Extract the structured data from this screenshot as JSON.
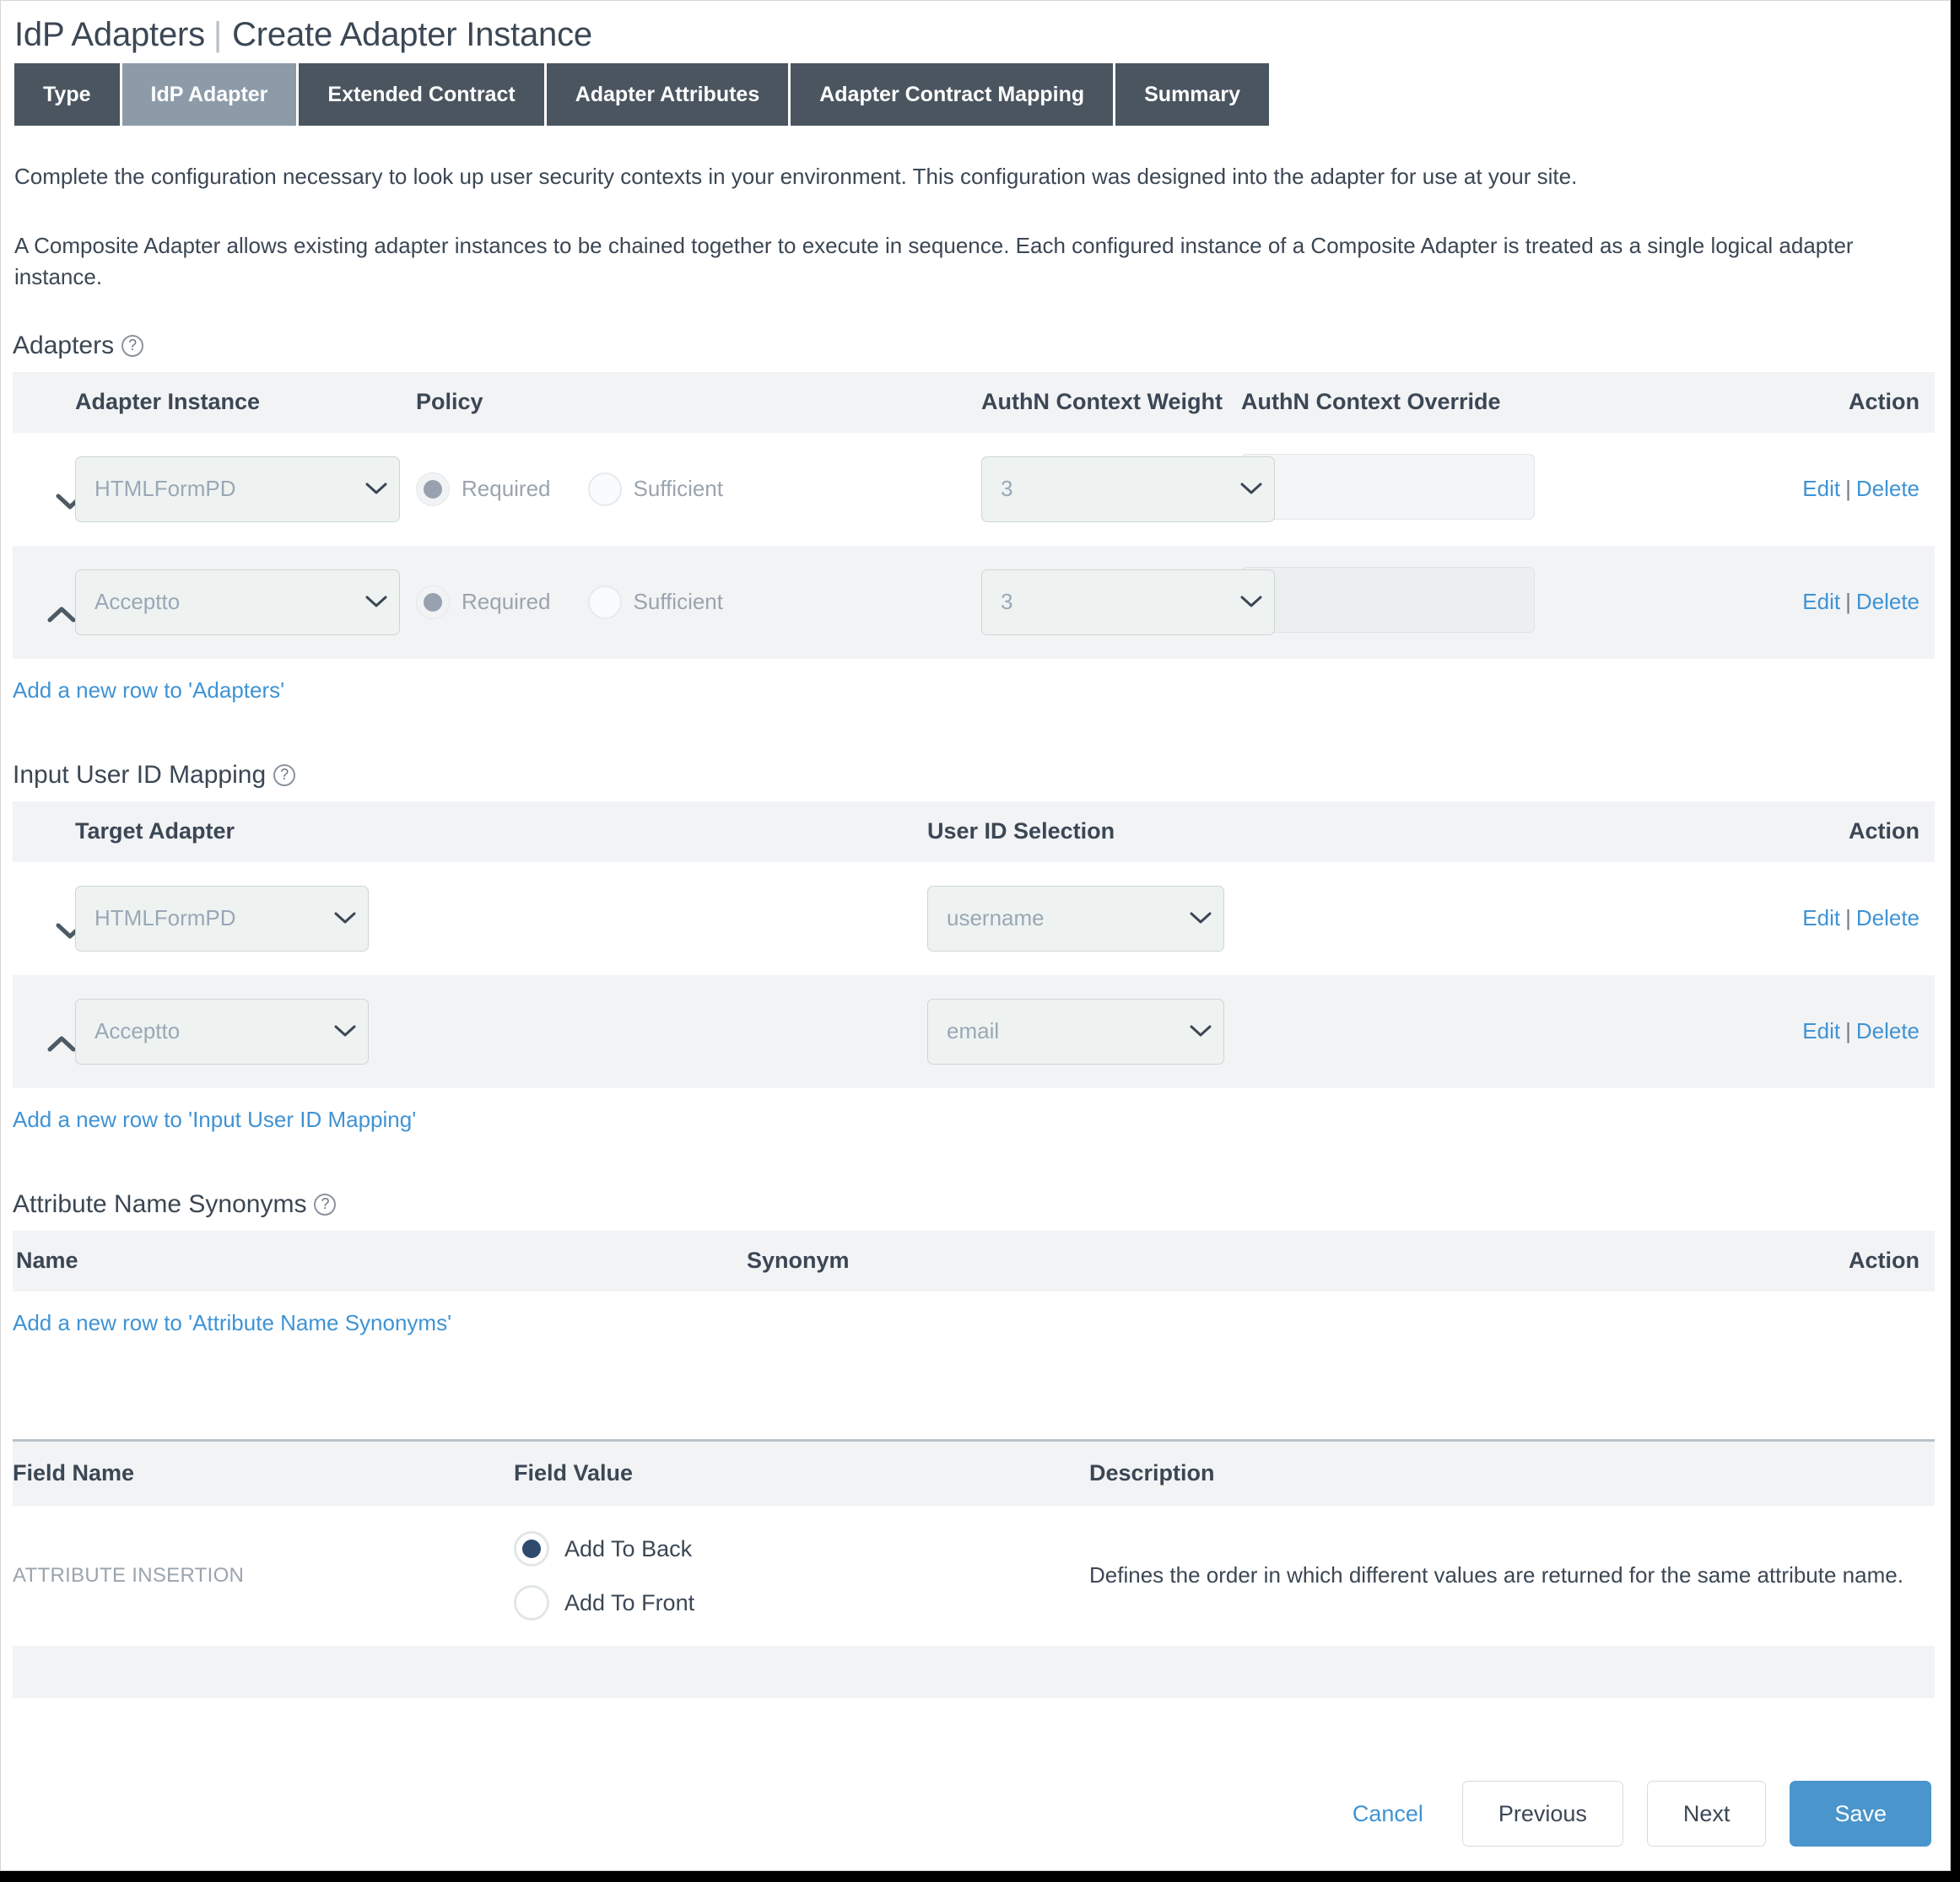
{
  "header": {
    "breadcrumb_parent": "IdP Adapters",
    "separator": "|",
    "title": "Create Adapter Instance"
  },
  "tabs": [
    {
      "label": "Type",
      "active": false
    },
    {
      "label": "IdP Adapter",
      "active": true
    },
    {
      "label": "Extended Contract",
      "active": false
    },
    {
      "label": "Adapter Attributes",
      "active": false
    },
    {
      "label": "Adapter Contract Mapping",
      "active": false
    },
    {
      "label": "Summary",
      "active": false
    }
  ],
  "intro": {
    "paragraph1": "Complete the configuration necessary to look up user security contexts in your environment. This configuration was designed into the adapter for use at your site.",
    "paragraph2": "A Composite Adapter allows existing adapter instances to be chained together to execute in sequence. Each configured instance of a Composite Adapter is treated as a single logical adapter instance."
  },
  "adapters_section": {
    "title": "Adapters",
    "help_glyph": "?",
    "columns": {
      "adapter_instance": "Adapter Instance",
      "policy": "Policy",
      "authn_context_weight": "AuthN Context Weight",
      "authn_context_override": "AuthN Context Override",
      "action": "Action"
    },
    "rows": [
      {
        "move_icon": "chevron-down-icon",
        "adapter_instance": "HTMLFormPD",
        "policy_options": [
          {
            "label": "Required",
            "selected": true
          },
          {
            "label": "Sufficient",
            "selected": false
          }
        ],
        "authn_context_weight": "3",
        "authn_context_override": "",
        "edit_label": "Edit",
        "separator": "|",
        "delete_label": "Delete"
      },
      {
        "move_icon": "chevron-up-icon",
        "adapter_instance": "Acceptto",
        "policy_options": [
          {
            "label": "Required",
            "selected": true
          },
          {
            "label": "Sufficient",
            "selected": false
          }
        ],
        "authn_context_weight": "3",
        "authn_context_override": "",
        "edit_label": "Edit",
        "separator": "|",
        "delete_label": "Delete"
      }
    ],
    "add_row_label": "Add a new row to 'Adapters'"
  },
  "input_user_id_section": {
    "title": "Input User ID Mapping",
    "help_glyph": "?",
    "columns": {
      "target_adapter": "Target Adapter",
      "user_id_selection": "User ID Selection",
      "action": "Action"
    },
    "rows": [
      {
        "move_icon": "chevron-down-icon",
        "target_adapter": "HTMLFormPD",
        "user_id_selection": "username",
        "edit_label": "Edit",
        "separator": "|",
        "delete_label": "Delete"
      },
      {
        "move_icon": "chevron-up-icon",
        "target_adapter": "Acceptto",
        "user_id_selection": "email",
        "edit_label": "Edit",
        "separator": "|",
        "delete_label": "Delete"
      }
    ],
    "add_row_label": "Add a new row to 'Input User ID Mapping'"
  },
  "attribute_synonyms_section": {
    "title": "Attribute Name Synonyms",
    "help_glyph": "?",
    "columns": {
      "name": "Name",
      "synonym": "Synonym",
      "action": "Action"
    },
    "rows": [],
    "add_row_label": "Add a new row to 'Attribute Name Synonyms'"
  },
  "field_table": {
    "columns": {
      "field_name": "Field Name",
      "field_value": "Field Value",
      "description": "Description"
    },
    "rows": [
      {
        "field_name": "ATTRIBUTE INSERTION",
        "options": [
          {
            "label": "Add To Back",
            "selected": true
          },
          {
            "label": "Add To Front",
            "selected": false
          }
        ],
        "description": "Defines the order in which different values are returned for the same attribute name."
      }
    ]
  },
  "footer": {
    "cancel_label": "Cancel",
    "previous_label": "Previous",
    "next_label": "Next",
    "save_label": "Save"
  },
  "colors": {
    "tab_inactive": "#4a555f",
    "tab_active": "#8d9ba9",
    "link": "#3f93d4",
    "primary_button": "#4a95cc",
    "header_row": "#f2f3f5",
    "select_fill": "#eef3f2",
    "radio_selected": "#2f4a6d"
  }
}
